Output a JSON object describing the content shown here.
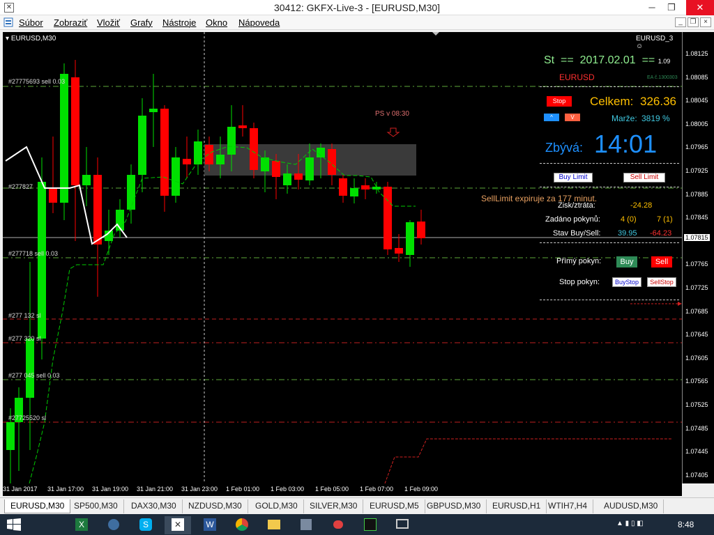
{
  "window": {
    "title": "30412: GKFX-Live-3 - [EURUSD,M30]",
    "minimize_glyph": "─",
    "maximize_glyph": "❐",
    "close_glyph": "✕"
  },
  "menu": [
    "Súbor",
    "Zobraziť",
    "Vložiť",
    "Grafy",
    "Nástroje",
    "Okno",
    "Nápoveda"
  ],
  "chart": {
    "symbol_label": "EURUSD,M30",
    "ea_label": "EURUSD_3",
    "order_labels": [
      "#27775693 sell 0.03",
      "#277827",
      "#277718 sell 0.03",
      "#277 132 sl",
      "#277 320 sl",
      "#277 045 sell 0.03",
      "#27725520 sl"
    ],
    "ps_label": "PS v 08:30",
    "sell_limit_note": "SellLimit expiruje za 177 minut.",
    "price_ticks": [
      "1.08125",
      "1.08085",
      "1.08045",
      "1.08005",
      "1.07965",
      "1.07925",
      "1.07885",
      "1.07845",
      "1.07815",
      "1.07765",
      "1.07725",
      "1.07685",
      "1.07645",
      "1.07605",
      "1.07565",
      "1.07525",
      "1.07485",
      "1.07445",
      "1.07405"
    ],
    "current_price": "1.07815",
    "time_ticks": [
      "31 Jan 2017",
      "31 Jan 17:00",
      "31 Jan 19:00",
      "31 Jan 21:00",
      "31 Jan 23:00",
      "1 Feb 01:00",
      "1 Feb 03:00",
      "1 Feb 05:00",
      "1 Feb 07:00",
      "1 Feb 09:00"
    ]
  },
  "panel": {
    "day": "St",
    "eq1": "==",
    "date": "2017.02.01",
    "eq2": "==",
    "version": "1.09",
    "symbol": "EURUSD",
    "ea_code": "EA č.1300303",
    "stop_button": "Stop",
    "celkem_label": "Celkem:",
    "celkem_value": "326.36",
    "btn_small_left": "^",
    "btn_small_right": "V",
    "marze_label": "Marže:",
    "marze_value": "3819 %",
    "zbyva_label": "Zbývá:",
    "zbyva_value": "14:01",
    "buy_limit": "Buy Limit",
    "sell_limit": "Sell Limit",
    "zisk_label": "Zisk/ztráta:",
    "zisk_value": "-24.28",
    "zadano_label": "Zadáno pokynů:",
    "zadano_buy": "4 (0)",
    "zadano_sell": "7 (1)",
    "stav_label": "Stav Buy/Sell:",
    "stav_buy": "39.95",
    "stav_sell": "-64.23",
    "primy_label": "Přímý pokyn:",
    "buy": "Buy",
    "sell": "Sell",
    "stop_label": "Stop pokyn:",
    "buystop": "BuyStop",
    "sellstop": "SellStop"
  },
  "tabs": [
    "EURUSD,M30",
    "SP500,M30",
    "DAX30,M30",
    "NZDUSD,M30",
    "GOLD,M30",
    "SILVER,M30",
    "EURUSD,M5",
    "GBPUSD,M30",
    "EURUSD,H1",
    "WTIH7,H4",
    "AUDUSD,M30"
  ],
  "taskbar": {
    "clock": "8:48"
  },
  "colors": {
    "bull": "#00e000",
    "bear": "#ff0000",
    "panel_green": "#90ee90",
    "panel_gold": "#ffc000",
    "panel_blue": "#1e90ff"
  }
}
